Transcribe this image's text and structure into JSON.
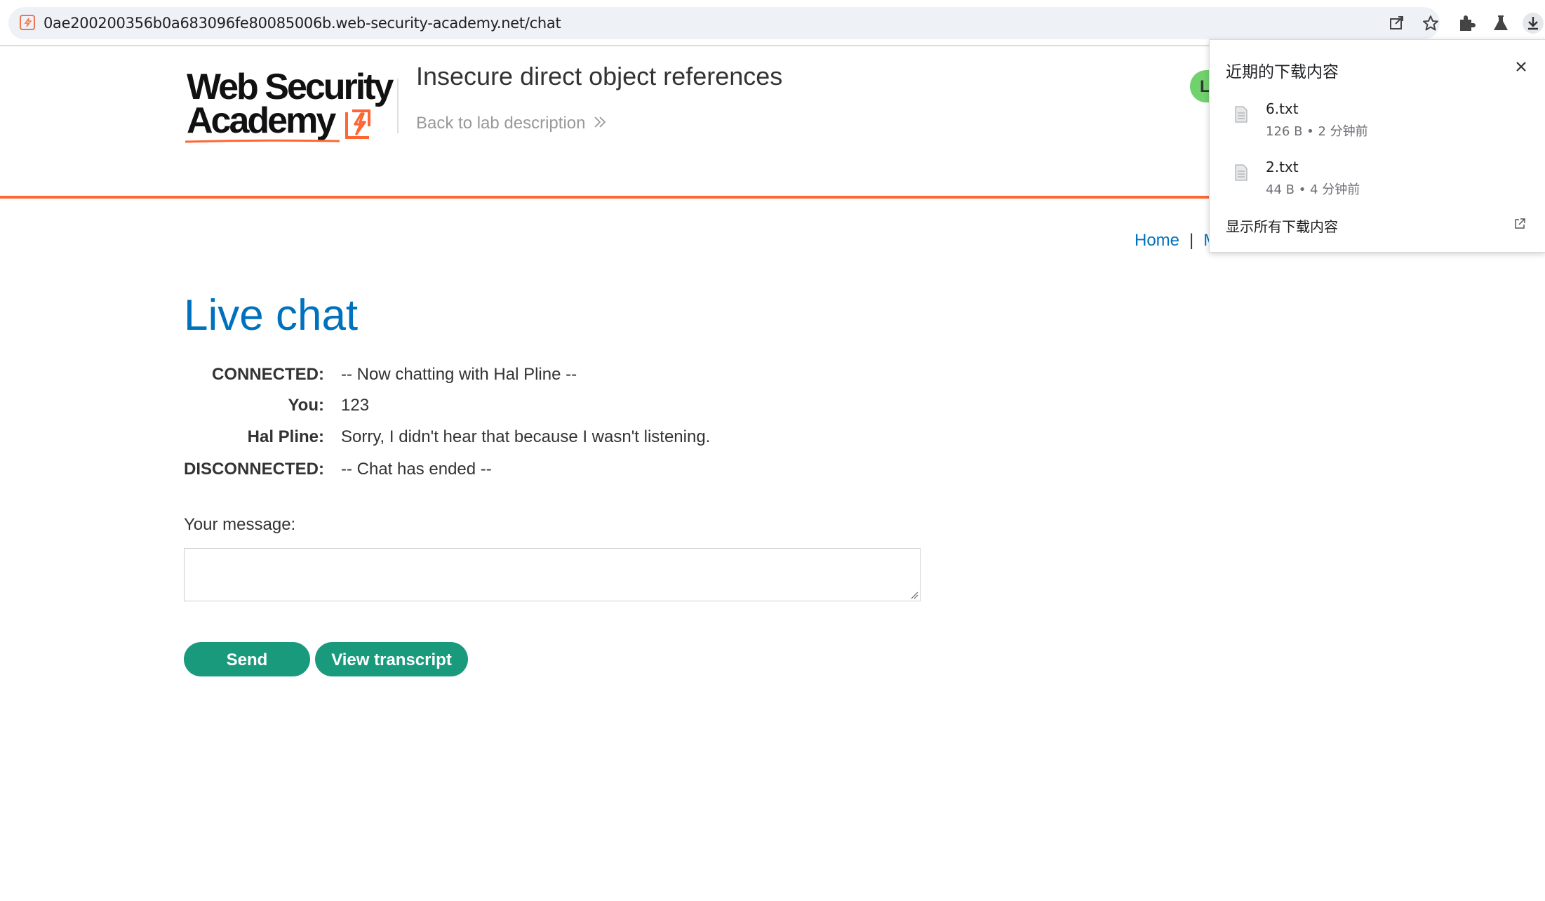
{
  "browser": {
    "url": "0ae200200356b0a683096fe80085006b.web-security-academy.net/chat",
    "icons": [
      "site-favicon-icon",
      "share-icon",
      "bookmark-star-icon",
      "extensions-icon",
      "labs-flask-icon",
      "download-icon"
    ]
  },
  "header": {
    "logo_line1": "Web Security",
    "logo_line2": "Academy",
    "lab_title": "Insecure direct object references",
    "back_link": "Back to lab description",
    "status_initial": "L"
  },
  "nav": {
    "home": "Home",
    "sep": "|",
    "next_partial": "M"
  },
  "main": {
    "title": "Live chat",
    "chat": [
      {
        "label": "CONNECTED:",
        "text": "-- Now chatting with Hal Pline --"
      },
      {
        "label": "You:",
        "text": "123"
      },
      {
        "label": "Hal Pline:",
        "text": "Sorry, I didn't hear that because I wasn't listening."
      },
      {
        "label": "DISCONNECTED:",
        "text": "-- Chat has ended --"
      }
    ],
    "message_label": "Your message:",
    "message_value": "",
    "send_button": "Send",
    "transcript_button": "View transcript"
  },
  "downloads": {
    "title": "近期的下载内容",
    "items": [
      {
        "name": "6.txt",
        "meta": "126 B • 2 分钟前"
      },
      {
        "name": "2.txt",
        "meta": "44 B • 4 分钟前"
      }
    ],
    "show_all": "显示所有下载内容"
  },
  "colors": {
    "accent_blue": "#0071bc",
    "brand_orange": "#ff6633",
    "button_green": "#199a7d",
    "status_green": "#70d16d"
  }
}
